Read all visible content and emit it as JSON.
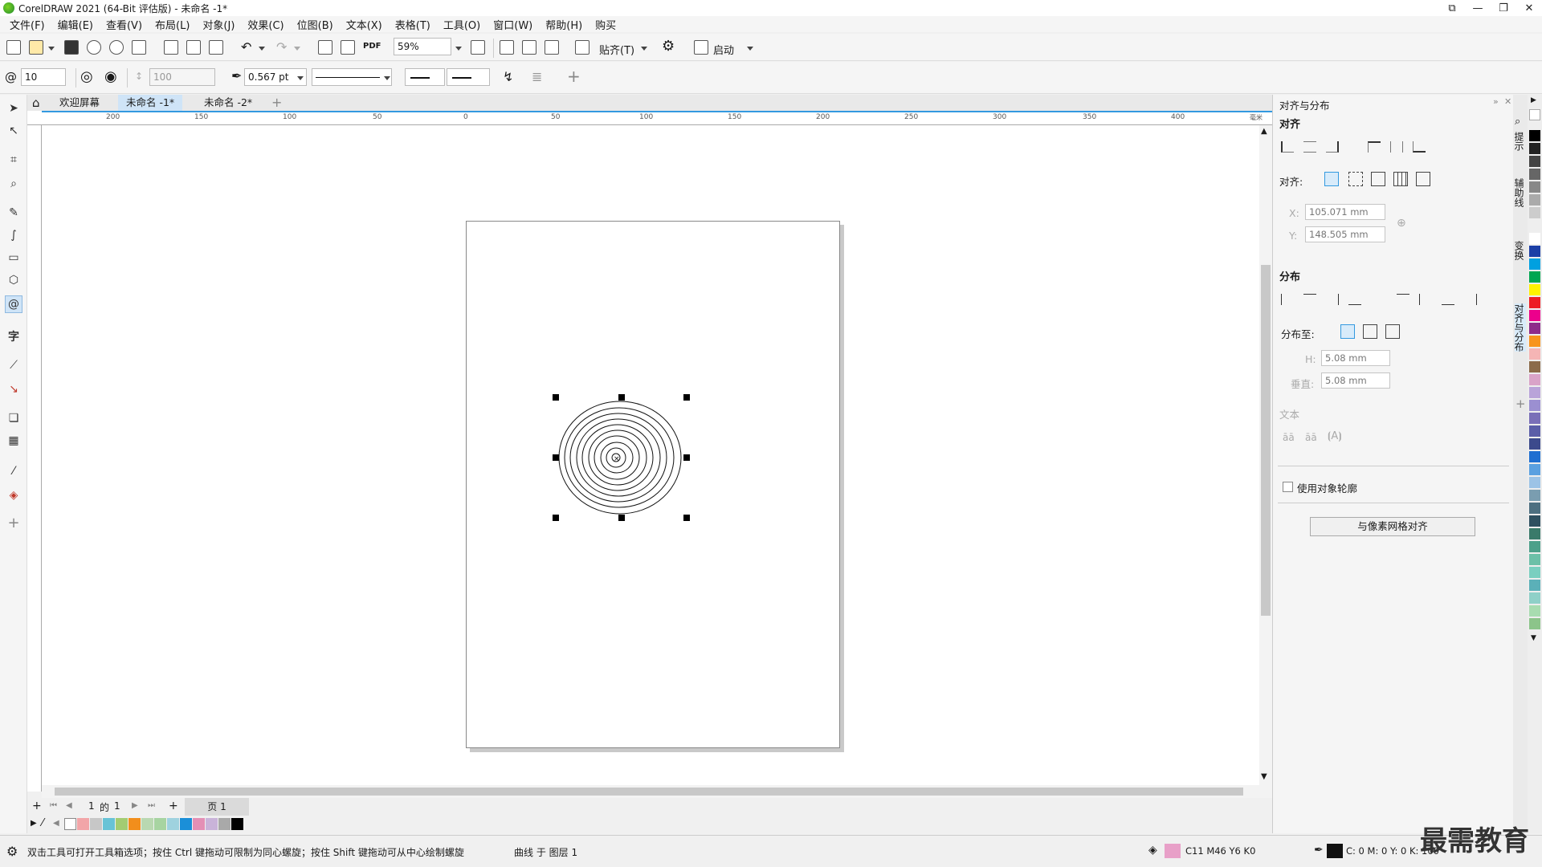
{
  "window": {
    "title": "CorelDRAW 2021 (64-Bit 评估版) - 未命名 -1*"
  },
  "menu": [
    "文件(F)",
    "编辑(E)",
    "查看(V)",
    "布局(L)",
    "对象(J)",
    "效果(C)",
    "位图(B)",
    "文本(X)",
    "表格(T)",
    "工具(O)",
    "窗口(W)",
    "帮助(H)",
    "购买"
  ],
  "toolbar": {
    "zoom": "59%",
    "snap_label": "贴齐(T)",
    "launch_label": "启动"
  },
  "propbar": {
    "revolutions": "10",
    "expansion": "100",
    "outline_width": "0.567 pt"
  },
  "tabs": [
    {
      "label": "欢迎屏幕",
      "active": false
    },
    {
      "label": "未命名 -1*",
      "active": true
    },
    {
      "label": "未命名 -2*",
      "active": false
    }
  ],
  "ruler": {
    "h_labels": [
      "200",
      "150",
      "100",
      "50",
      "0",
      "50",
      "100",
      "150",
      "200",
      "250",
      "300",
      "350",
      "400"
    ],
    "unit": "毫米"
  },
  "pagenav": {
    "current": "1",
    "of_label": "的",
    "total": "1",
    "page_tab": "页 1"
  },
  "status": {
    "hint": "双击工具可打开工具箱选项；按住 Ctrl 键拖动可限制为同心螺旋；按住 Shift 键拖动可从中心绘制螺旋",
    "object": "曲线 于 图层 1",
    "fill_color": "C11 M46 Y6 K0",
    "outline_values": "C: 0 M: 0 Y: 0 K: 100"
  },
  "docker": {
    "title": "对齐与分布",
    "align_section": "对齐",
    "align_to_label": "对齐:",
    "x_label": "X:",
    "x_value": "105.071 mm",
    "y_label": "Y:",
    "y_value": "148.505 mm",
    "distribute_section": "分布",
    "distribute_to_label": "分布至:",
    "h_label": "H:",
    "h_value": "5.08 mm",
    "v_label": "垂直:",
    "v_value": "5.08 mm",
    "text_section": "文本",
    "use_outline_label": "使用对象轮廓",
    "pixel_grid_button": "与像素网格对齐"
  },
  "vtabs": [
    "提示",
    "辅助线",
    "变换",
    "对齐与分布"
  ],
  "watermark": "最需教育",
  "colors": {
    "accent": "#3399e0",
    "fill_swatch": "#e8a0c8"
  }
}
